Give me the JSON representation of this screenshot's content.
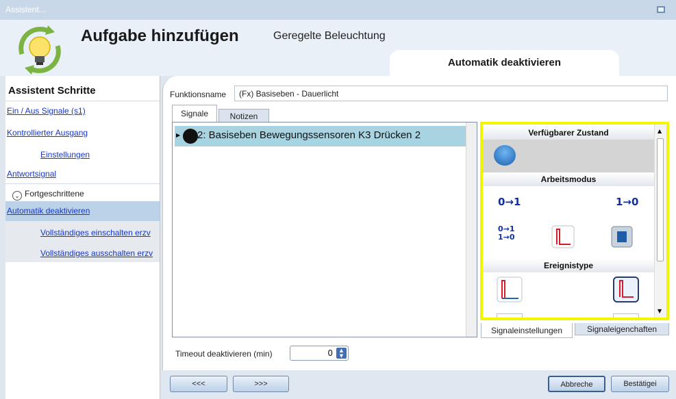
{
  "window": {
    "title": "Assistent..."
  },
  "header": {
    "title": "Aufgabe hinzufügen",
    "subtitle": "Geregelte Beleuchtung",
    "active_tab": "Automatik deaktivieren"
  },
  "sidebar": {
    "heading": "Assistent Schritte",
    "items": [
      {
        "label": "Ein / Aus Signale (s1)"
      },
      {
        "label": "Kontrollierter Ausgang"
      },
      {
        "label": "Einstellungen"
      },
      {
        "label": "Antwortsignal"
      },
      {
        "label": "Fortgeschrittene"
      },
      {
        "label": "Automatik deaktivieren"
      },
      {
        "label": "Vollständiges einschalten erzv"
      },
      {
        "label": "Vollständiges ausschalten erzv"
      }
    ]
  },
  "main": {
    "function_name_label": "Funktionsname",
    "function_name_value": "(Fx) Basiseben - Dauerlicht",
    "tabs": [
      {
        "label": "Signale"
      },
      {
        "label": "Notizen"
      }
    ],
    "signals": [
      {
        "label": "2: Basiseben Bewegungssensoren K3 Drücken 2"
      }
    ],
    "right_panel": {
      "sections": [
        {
          "title": "Verfügbarer Zustand"
        },
        {
          "title": "Arbeitsmodus"
        },
        {
          "title": "Ereignistype"
        }
      ],
      "mode_icons": [
        "0→1",
        "1→0"
      ],
      "bottom_tabs": [
        {
          "label": "Signaleinstellungen"
        },
        {
          "label": "Signaleigenchaften"
        }
      ],
      "highlight_color": "#f5f500"
    },
    "timeout_label": "Timeout deaktivieren (min)",
    "timeout_value": "0"
  },
  "footer": {
    "prev_label": "<<<",
    "next_label": ">>>",
    "cancel_label": "Abbreche",
    "confirm_label": "Bestätigei"
  }
}
